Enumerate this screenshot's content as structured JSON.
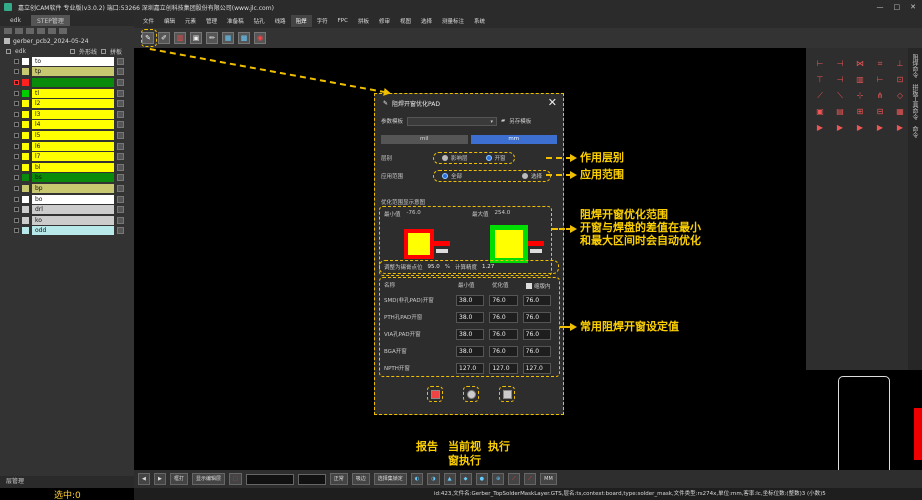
{
  "window": {
    "title": "嘉立创CAM软件 专业版(v3.0.2) 端口:53266    深圳嘉立创科技集团股份有限公司(www.jlc.com)"
  },
  "left_panel": {
    "tabs": [
      "edk",
      "STEP管理"
    ],
    "file_name": "gerber_pcb2_2024-05-24",
    "header_label": "edk",
    "outline_label": "外形线",
    "panel_label": "拼板",
    "layers": [
      {
        "name": "to",
        "color": "#ffffff",
        "swatch": "#ffffff"
      },
      {
        "name": "tp",
        "color": "#c8c870",
        "swatch": "#c8c870"
      },
      {
        "name": "",
        "color": "#0a8a0a",
        "swatch": "#ff2020",
        "selected": true
      },
      {
        "name": "tl",
        "color": "#ffff00",
        "swatch": "#00cc00"
      },
      {
        "name": "l2",
        "color": "#ffff00",
        "swatch": "#ffff00"
      },
      {
        "name": "l3",
        "color": "#ffff00",
        "swatch": "#ffff00"
      },
      {
        "name": "l4",
        "color": "#ffff00",
        "swatch": "#ffff00"
      },
      {
        "name": "l5",
        "color": "#ffff00",
        "swatch": "#ffff00"
      },
      {
        "name": "l6",
        "color": "#ffff00",
        "swatch": "#ffff00"
      },
      {
        "name": "l7",
        "color": "#ffff00",
        "swatch": "#ffff00"
      },
      {
        "name": "bl",
        "color": "#ffff00",
        "swatch": "#ffff00"
      },
      {
        "name": "bs",
        "color": "#0a8a0a",
        "swatch": "#0a8a0a"
      },
      {
        "name": "bp",
        "color": "#c8c870",
        "swatch": "#c8c870"
      },
      {
        "name": "bo",
        "color": "#ffffff",
        "swatch": "#ffffff"
      },
      {
        "name": "drl",
        "color": "#cccccc",
        "swatch": "#cccccc"
      },
      {
        "name": "ko",
        "color": "#cccccc",
        "swatch": "#cccccc"
      },
      {
        "name": "odd",
        "color": "#b7e8ea",
        "swatch": "#b7e8ea"
      }
    ],
    "bottom_label": "层管理",
    "selected_count": "选中:0"
  },
  "menu": [
    "文件",
    "编辑",
    "元素",
    "管理",
    "准备稿",
    "钻孔",
    "线路",
    "阻焊",
    "字符",
    "FPC",
    "拼板",
    "修审",
    "视图",
    "选择",
    "测量标注",
    "系统"
  ],
  "menu_active": "阻焊",
  "dialog": {
    "title": "阻焊开窗优化PAD",
    "param_label": "参数模板",
    "save_template": "另存模板",
    "mode_tabs": [
      "mil",
      "mm"
    ],
    "mode_active": "mm",
    "layer_label": "层别",
    "layer_options": [
      "影响层",
      "开窗"
    ],
    "layer_selected": "开窗",
    "range_label": "应用范围",
    "range_options": [
      "全部",
      "选择"
    ],
    "range_selected": "全部",
    "opt_section_label": "优化范围显示意图",
    "min_label": "最小值",
    "min_value": "-76.0",
    "max_label": "最大值",
    "max_value": "254.0",
    "ratio_label": "调整为锡膏点位",
    "ratio_value": "95.0",
    "ratio_unit": "%",
    "calc_label": "计算精度",
    "calc_value": "1.27",
    "table": {
      "headers": [
        "名称",
        "最小值",
        "优化值",
        "缩版内"
      ],
      "rows": [
        {
          "name": "SMD(非孔PAD)开窗",
          "min": "38.0",
          "opt": "76.0",
          "max": "76.0"
        },
        {
          "name": "PTH孔PAD开窗",
          "min": "38.0",
          "opt": "76.0",
          "max": "76.0"
        },
        {
          "name": "VIA孔PAD开窗",
          "min": "38.0",
          "opt": "76.0",
          "max": "76.0"
        },
        {
          "name": "BGA开窗",
          "min": "38.0",
          "opt": "76.0",
          "max": "76.0"
        },
        {
          "name": "NPTH开窗",
          "min": "127.0",
          "opt": "127.0",
          "max": "127.0"
        }
      ]
    }
  },
  "annotations": {
    "layer": "作用层别",
    "range": "应用范围",
    "opt_line1": "阻焊开窗优化范围",
    "opt_line2": "开窗与焊盘的差值在最小",
    "opt_line3": "和最大区间时会自动优化",
    "table": "常用阻焊开窗设定值",
    "report": "报告",
    "current_line1": "当前视",
    "current_line2": "窗执行",
    "execute": "执行"
  },
  "right_panel": {
    "side_labels": [
      "阻焊命令",
      "拼板工具命令",
      "命令"
    ]
  },
  "bottom_bar": {
    "zoom_option": "框打",
    "display_label": "显示编辑层",
    "mode_option": "正常",
    "snap_label": "吸边",
    "select_label": "选择集锁定",
    "unit": "MM"
  },
  "status": "id:423,文件名:Gerber_TopSolderMaskLayer.GTS,层名:ts,context:board,type:solder_mask,文件类型:rs274x,单位:mm,客率:lc,坐标位数:(整数)3 (小数)5"
}
